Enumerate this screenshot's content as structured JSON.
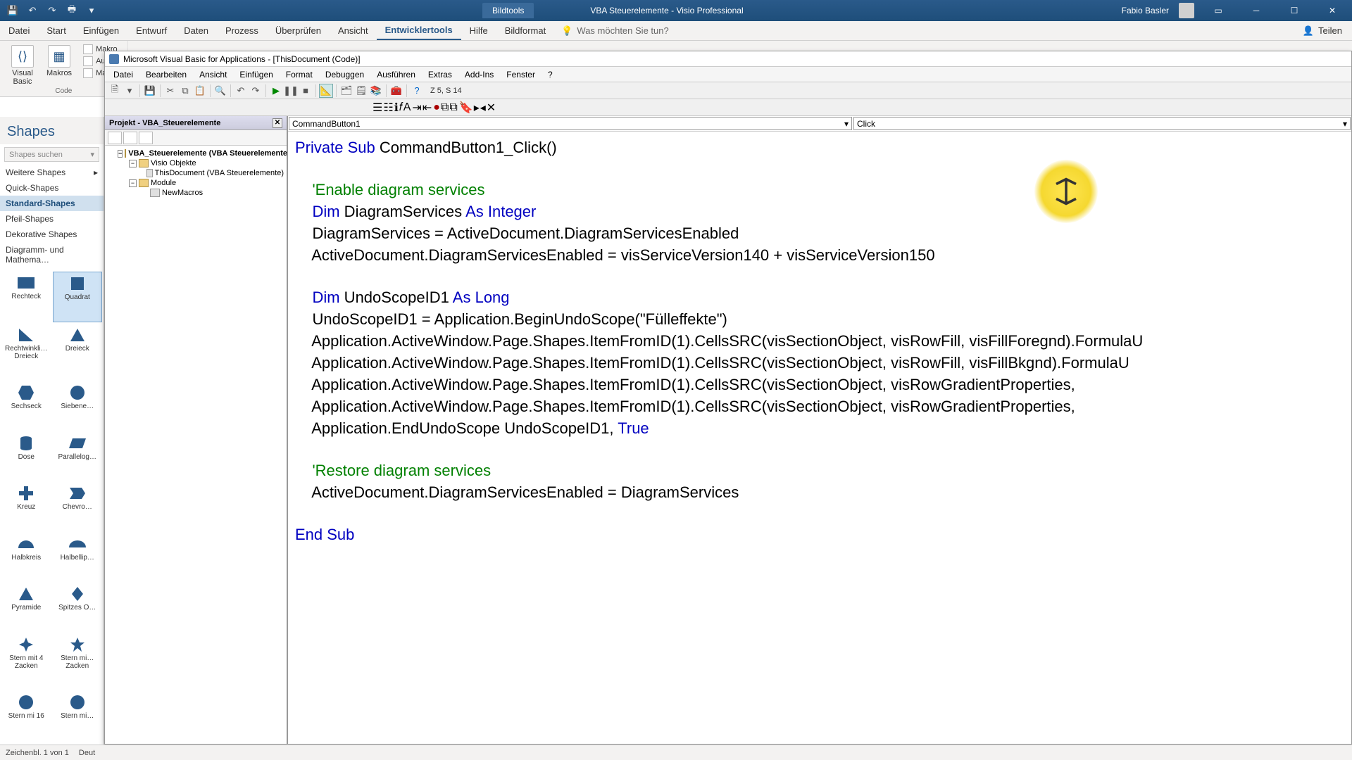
{
  "title": {
    "app": "VBA Steuerelemente - Visio Professional",
    "context_tab": "Bildtools",
    "user": "Fabio Basler"
  },
  "qat": {
    "save": "💾",
    "undo": "↶",
    "redo": "↷",
    "print": "🖶"
  },
  "ribbon": {
    "tabs": [
      "Datei",
      "Start",
      "Einfügen",
      "Entwurf",
      "Daten",
      "Prozess",
      "Überprüfen",
      "Ansicht",
      "Entwicklertools",
      "Hilfe",
      "Bildformat"
    ],
    "active": "Entwicklertools",
    "search_prompt": "Was möchten Sie tun?",
    "share": "Teilen"
  },
  "ribbon_groups": {
    "code": {
      "visual_basic": "Visual\nBasic",
      "makros": "Makros",
      "makro_aufz": "Makro",
      "aufz": "Aufz",
      "sicherheit": "Makro",
      "label": "Code"
    }
  },
  "vba": {
    "title": "Microsoft Visual Basic for Applications - [ThisDocument (Code)]",
    "menus": [
      "Datei",
      "Bearbeiten",
      "Ansicht",
      "Einfügen",
      "Format",
      "Debuggen",
      "Ausführen",
      "Extras",
      "Add-Ins",
      "Fenster",
      "?"
    ],
    "cursor_pos": "Z 5, S 14",
    "project": {
      "title": "Projekt - VBA_Steuerelemente",
      "root": "VBA_Steuerelemente (VBA Steuerelemente)",
      "folder1": "Visio Objekte",
      "item1": "ThisDocument (VBA Steuerelemente)",
      "folder2": "Module",
      "item2": "NewMacros"
    },
    "dd_object": "CommandButton1",
    "dd_proc": "Click",
    "code": {
      "l1a": "Private Sub",
      "l1b": " CommandButton1_Click()",
      "l3": "    'Enable diagram services",
      "l4a": "    ",
      "l4b": "Dim",
      "l4c": " DiagramServices ",
      "l4d": "As Integer",
      "l5": "    DiagramServices = ActiveDocument.DiagramServicesEnabled",
      "l6": "    ActiveDocument.DiagramServicesEnabled = visServiceVersion140 + visServiceVersion150",
      "l8a": "    ",
      "l8b": "Dim",
      "l8c": " UndoScopeID1 ",
      "l8d": "As Long",
      "l9": "    UndoScopeID1 = Application.BeginUndoScope(\"Fülleffekte\")",
      "l10": "    Application.ActiveWindow.Page.Shapes.ItemFromID(1).CellsSRC(visSectionObject, visRowFill, visFillForegnd).FormulaU",
      "l11": "    Application.ActiveWindow.Page.Shapes.ItemFromID(1).CellsSRC(visSectionObject, visRowFill, visFillBkgnd).FormulaU",
      "l12": "    Application.ActiveWindow.Page.Shapes.ItemFromID(1).CellsSRC(visSectionObject, visRowGradientProperties,",
      "l13": "    Application.ActiveWindow.Page.Shapes.ItemFromID(1).CellsSRC(visSectionObject, visRowGradientProperties,",
      "l14": "    Application.EndUndoScope UndoScopeID1, ",
      "l14b": "True",
      "l16": "    'Restore diagram services",
      "l17": "    ActiveDocument.DiagramServicesEnabled = DiagramServices",
      "l19": "End Sub"
    }
  },
  "shapes": {
    "title": "Shapes",
    "search_ph": "Shapes suchen",
    "cats": [
      "Weitere Shapes",
      "Quick-Shapes",
      "Standard-Shapes",
      "Pfeil-Shapes",
      "Dekorative Shapes",
      "Diagramm- und Mathema…"
    ],
    "sel_cat": "Standard-Shapes",
    "items": [
      {
        "n": "Rechteck"
      },
      {
        "n": "Quadrat"
      },
      {
        "n": "Rechtwinkli… Dreieck"
      },
      {
        "n": "Dreieck"
      },
      {
        "n": "Sechseck"
      },
      {
        "n": "Siebene…"
      },
      {
        "n": "Dose"
      },
      {
        "n": "Parallelog…"
      },
      {
        "n": "Kreuz"
      },
      {
        "n": "Chevro…"
      },
      {
        "n": "Halbkreis"
      },
      {
        "n": "Halbellip…"
      },
      {
        "n": "Pyramide"
      },
      {
        "n": "Spitzes O…"
      },
      {
        "n": "Stern mit 4 Zacken"
      },
      {
        "n": "Stern mi… Zacken"
      },
      {
        "n": "Stern mi 16"
      },
      {
        "n": "Stern mi…"
      }
    ]
  },
  "status": {
    "left": "Zeichenbl. 1 von 1",
    "lang": "Deut"
  }
}
